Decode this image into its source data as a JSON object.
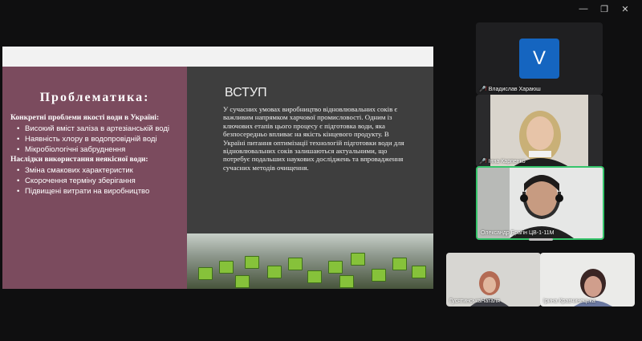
{
  "window": {
    "minimize_icon": "minimize-icon",
    "restore_icon": "restore-icon",
    "close_icon": "close-icon"
  },
  "slide": {
    "left": {
      "title": "Проблематика:",
      "section1_head": "Конкретні проблеми якості води в Україні:",
      "section1_items": [
        "Високий вміст заліза в артезіанській воді",
        "Наявність хлору в водопровідній воді",
        "Мікробіологічні забруднення"
      ],
      "section2_head": "Наслідки використання неякісної води:",
      "section2_items": [
        "Зміна смакових характеристик",
        "Скорочення терміну зберігання",
        "Підвищені витрати на виробництво"
      ]
    },
    "right": {
      "title": "ВСТУП",
      "body": "У сучасних умовах виробництво відновлювальних соків є важливим напрямком харчової промисловості. Одним із ключових етапів цього процесу є підготовка води, яка безпосередньо впливає на якість кінцевого продукту. В Україні питання оптимізації технологій підготовки води для відновлювальних соків залишаються актуальними, що потребує подальших наукових досліджень та впровадження сучасних методів очищення."
    }
  },
  "participants": [
    {
      "name": "Владислав Хараюш",
      "avatar_letter": "V",
      "muted": true
    },
    {
      "name": "Інна Карпенко",
      "muted": true
    },
    {
      "name": "Олександр Брагін ЦВ-1-11М",
      "muted": false,
      "active": true
    },
    {
      "name": "ГусятинськаНаталя",
      "muted": false
    },
    {
      "name": "Ірина Кравчинецька",
      "muted": false
    }
  ],
  "colors": {
    "slide_left_bg": "#7b4b5e",
    "slide_right_bg": "#3e3e3e",
    "active_speaker": "#35c46a",
    "avatar_bg": "#1565c0"
  }
}
